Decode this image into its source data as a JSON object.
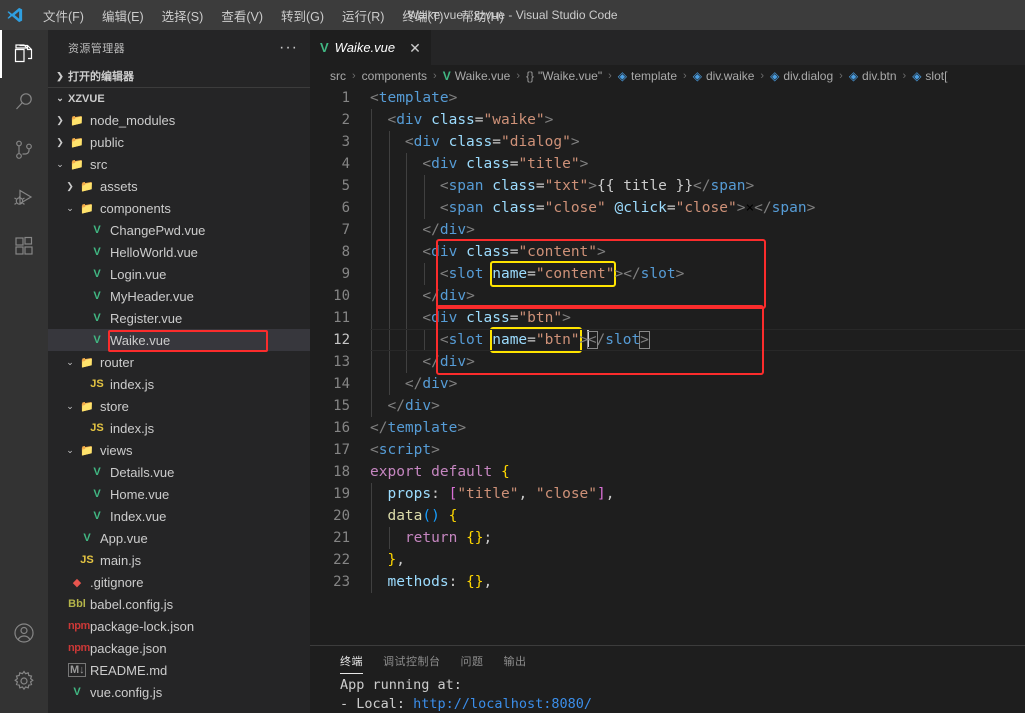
{
  "window": {
    "title": "Waike.vue - xzvue - Visual Studio Code"
  },
  "menubar": {
    "items": [
      {
        "label": "文件(F)",
        "name": "menu-file"
      },
      {
        "label": "编辑(E)",
        "name": "menu-edit"
      },
      {
        "label": "选择(S)",
        "name": "menu-selection"
      },
      {
        "label": "查看(V)",
        "name": "menu-view"
      },
      {
        "label": "转到(G)",
        "name": "menu-go"
      },
      {
        "label": "运行(R)",
        "name": "menu-run"
      },
      {
        "label": "终端(T)",
        "name": "menu-terminal"
      },
      {
        "label": "帮助(H)",
        "name": "menu-help"
      }
    ]
  },
  "activitybar": {
    "top": [
      "explorer-icon",
      "search-icon",
      "source-control-icon",
      "run-debug-icon",
      "extensions-icon"
    ],
    "bottom": [
      "account-icon",
      "settings-gear-icon"
    ]
  },
  "sidebar": {
    "header": "资源管理器",
    "more_label": "···",
    "open_editors_label": "打开的编辑器",
    "project_label": "XZVUE",
    "tree": [
      {
        "label": "node_modules",
        "type": "folder",
        "icon": "folder-node",
        "indent": 1,
        "twisty": "collapsed"
      },
      {
        "label": "public",
        "type": "folder",
        "icon": "folder-public",
        "indent": 1,
        "twisty": "collapsed"
      },
      {
        "label": "src",
        "type": "folder",
        "icon": "folder-src",
        "indent": 1,
        "twisty": "expanded"
      },
      {
        "label": "assets",
        "type": "folder",
        "icon": "folder-assets",
        "indent": 2,
        "twisty": "collapsed"
      },
      {
        "label": "components",
        "type": "folder",
        "icon": "folder-components",
        "indent": 2,
        "twisty": "expanded"
      },
      {
        "label": "ChangePwd.vue",
        "type": "file",
        "icon": "vue",
        "indent": 3,
        "twisty": "none"
      },
      {
        "label": "HelloWorld.vue",
        "type": "file",
        "icon": "vue",
        "indent": 3,
        "twisty": "none"
      },
      {
        "label": "Login.vue",
        "type": "file",
        "icon": "vue",
        "indent": 3,
        "twisty": "none"
      },
      {
        "label": "MyHeader.vue",
        "type": "file",
        "icon": "vue",
        "indent": 3,
        "twisty": "none"
      },
      {
        "label": "Register.vue",
        "type": "file",
        "icon": "vue",
        "indent": 3,
        "twisty": "none"
      },
      {
        "label": "Waike.vue",
        "type": "file",
        "icon": "vue",
        "indent": 3,
        "twisty": "none",
        "selected": true,
        "highlighted": true
      },
      {
        "label": "router",
        "type": "folder",
        "icon": "folder-yellow",
        "indent": 2,
        "twisty": "expanded"
      },
      {
        "label": "index.js",
        "type": "file",
        "icon": "js",
        "indent": 3,
        "twisty": "none"
      },
      {
        "label": "store",
        "type": "folder",
        "icon": "folder-yellow",
        "indent": 2,
        "twisty": "expanded"
      },
      {
        "label": "index.js",
        "type": "file",
        "icon": "js",
        "indent": 3,
        "twisty": "none"
      },
      {
        "label": "views",
        "type": "folder",
        "icon": "folder-views",
        "indent": 2,
        "twisty": "expanded"
      },
      {
        "label": "Details.vue",
        "type": "file",
        "icon": "vue",
        "indent": 3,
        "twisty": "none"
      },
      {
        "label": "Home.vue",
        "type": "file",
        "icon": "vue",
        "indent": 3,
        "twisty": "none"
      },
      {
        "label": "Index.vue",
        "type": "file",
        "icon": "vue",
        "indent": 3,
        "twisty": "none"
      },
      {
        "label": "App.vue",
        "type": "file",
        "icon": "vue",
        "indent": 2,
        "twisty": "none"
      },
      {
        "label": "main.js",
        "type": "file",
        "icon": "js",
        "indent": 2,
        "twisty": "none"
      },
      {
        "label": ".gitignore",
        "type": "file",
        "icon": "git",
        "indent": 1,
        "twisty": "none"
      },
      {
        "label": "babel.config.js",
        "type": "file",
        "icon": "babel",
        "indent": 1,
        "twisty": "none"
      },
      {
        "label": "package-lock.json",
        "type": "file",
        "icon": "npm",
        "indent": 1,
        "twisty": "none"
      },
      {
        "label": "package.json",
        "type": "file",
        "icon": "npm",
        "indent": 1,
        "twisty": "none"
      },
      {
        "label": "README.md",
        "type": "file",
        "icon": "md",
        "indent": 1,
        "twisty": "none"
      },
      {
        "label": "vue.config.js",
        "type": "file",
        "icon": "vuecfg",
        "indent": 1,
        "twisty": "none"
      }
    ]
  },
  "editor": {
    "tab": {
      "label": "Waike.vue",
      "icon": "vue-icon",
      "close": "✕",
      "preview": true
    },
    "breadcrumb": [
      {
        "text": "src",
        "icon": "none"
      },
      {
        "text": "components",
        "icon": "none"
      },
      {
        "text": "Waike.vue",
        "icon": "vue"
      },
      {
        "text": "\"Waike.vue\"",
        "icon": "braces"
      },
      {
        "text": "template",
        "icon": "tag"
      },
      {
        "text": "div.waike",
        "icon": "tag"
      },
      {
        "text": "div.dialog",
        "icon": "tag"
      },
      {
        "text": "div.btn",
        "icon": "tag"
      },
      {
        "text": "slot[",
        "icon": "tag"
      }
    ],
    "breadcrumb_sep": "›",
    "active_line": 12,
    "lines": [
      {
        "n": 1,
        "code": "<template>"
      },
      {
        "n": 2,
        "code": "  <div class=\"waike\">"
      },
      {
        "n": 3,
        "code": "    <div class=\"dialog\">"
      },
      {
        "n": 4,
        "code": "      <div class=\"title\">"
      },
      {
        "n": 5,
        "code": "        <span class=\"txt\">{{ title }}</span>"
      },
      {
        "n": 6,
        "code": "        <span class=\"close\" @click=\"close\">×</span>"
      },
      {
        "n": 7,
        "code": "      </div>"
      },
      {
        "n": 8,
        "code": "      <div class=\"content\">"
      },
      {
        "n": 9,
        "code": "        <slot name=\"content\"></slot>"
      },
      {
        "n": 10,
        "code": "      </div>"
      },
      {
        "n": 11,
        "code": "      <div class=\"btn\">"
      },
      {
        "n": 12,
        "code": "        <slot name=\"btn\"></slot>"
      },
      {
        "n": 13,
        "code": "      </div>"
      },
      {
        "n": 14,
        "code": "    </div>"
      },
      {
        "n": 15,
        "code": "  </div>"
      },
      {
        "n": 16,
        "code": "</template>"
      },
      {
        "n": 17,
        "code": "<script>"
      },
      {
        "n": 18,
        "code": "export default {"
      },
      {
        "n": 19,
        "code": "  props: [\"title\", \"close\"],"
      },
      {
        "n": 20,
        "code": "  data() {"
      },
      {
        "n": 21,
        "code": "    return {};"
      },
      {
        "n": 22,
        "code": "  },"
      },
      {
        "n": 23,
        "code": "  methods: {},"
      }
    ]
  },
  "panel": {
    "tabs": [
      {
        "label": "终端",
        "active": true
      },
      {
        "label": "调试控制台",
        "active": false
      },
      {
        "label": "问题",
        "active": false
      },
      {
        "label": "输出",
        "active": false
      }
    ],
    "terminal": {
      "line1": "App running at:",
      "line2_label": "- Local:   ",
      "line2_url": "http://localhost:8080/"
    }
  },
  "colors": {
    "accent_red_box": "#fb2c2c",
    "accent_yellow_box": "#ffe400",
    "vue_green": "#41b883",
    "selection_blue": "#264f78"
  }
}
